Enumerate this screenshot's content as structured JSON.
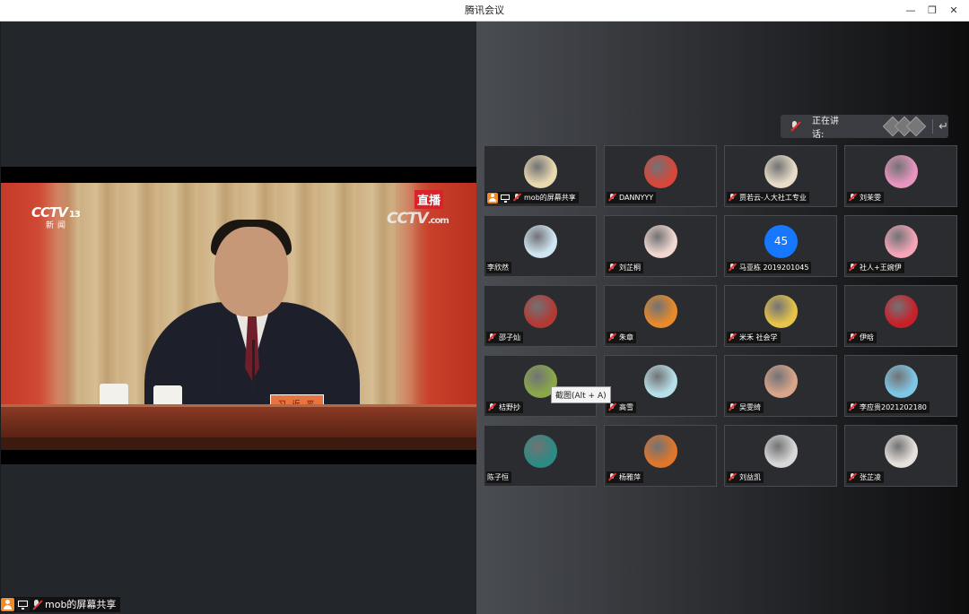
{
  "window": {
    "title": "腾讯会议",
    "min_icon": "minimize-icon",
    "max_icon": "restore-icon",
    "close_icon": "close-icon"
  },
  "shared_screen": {
    "channel_logo": "CCTV",
    "channel_number": "13",
    "channel_sub": "新闻",
    "live_badge": "直播",
    "watermark": "CCTV",
    "watermark_suffix": ".com",
    "nameplate": "习 近 平",
    "share_label": "mob的屏幕共享"
  },
  "speaking": {
    "label": "正在讲话:"
  },
  "tooltip": "截图(Alt + A)",
  "participants": [
    {
      "name": "mob的屏幕共享",
      "host": true,
      "sharing": true,
      "muted": true,
      "avatar_color": "#e9d9b0"
    },
    {
      "name": "DANNYYY",
      "muted": true,
      "avatar_color": "#d9463a"
    },
    {
      "name": "贾若云-人大社工专业",
      "muted": true,
      "avatar_color": "#e8dcc8"
    },
    {
      "name": "刘茉雯",
      "muted": true,
      "avatar_color": "#e895c0"
    },
    {
      "name": "李欣然",
      "muted": false,
      "avatar_color": "#cfe6f2"
    },
    {
      "name": "刘芷桐",
      "muted": true,
      "avatar_color": "#f0d7d0"
    },
    {
      "name": "马亚栋 2019201045",
      "muted": true,
      "avatar_text": "45",
      "avatar_color": "#1677ff"
    },
    {
      "name": "社人+王婉伊",
      "muted": true,
      "avatar_color": "#f4a5b8"
    },
    {
      "name": "邵子灿",
      "muted": true,
      "avatar_color": "#b23a35"
    },
    {
      "name": "朱章",
      "muted": true,
      "avatar_color": "#e88a2a"
    },
    {
      "name": "米禾 社会学",
      "muted": true,
      "avatar_color": "#e7c34a"
    },
    {
      "name": "伊晗",
      "muted": true,
      "avatar_color": "#c8202a"
    },
    {
      "name": "桔野抄",
      "muted": true,
      "avatar_color": "#8aa84a"
    },
    {
      "name": "高雪",
      "muted": true,
      "avatar_color": "#b7dfe8"
    },
    {
      "name": "吴雯绮",
      "muted": true,
      "avatar_color": "#d9a58a"
    },
    {
      "name": "李应贵2021202180",
      "muted": true,
      "avatar_color": "#7fc7e6"
    },
    {
      "name": "陈子恒",
      "muted": false,
      "avatar_color": "#2d8a84"
    },
    {
      "name": "杨雅萍",
      "muted": true,
      "avatar_color": "#e0762b"
    },
    {
      "name": "刘益凯",
      "muted": true,
      "avatar_color": "#d8d8d8"
    },
    {
      "name": "张芷凌",
      "muted": true,
      "avatar_color": "#e7e1dc"
    }
  ]
}
